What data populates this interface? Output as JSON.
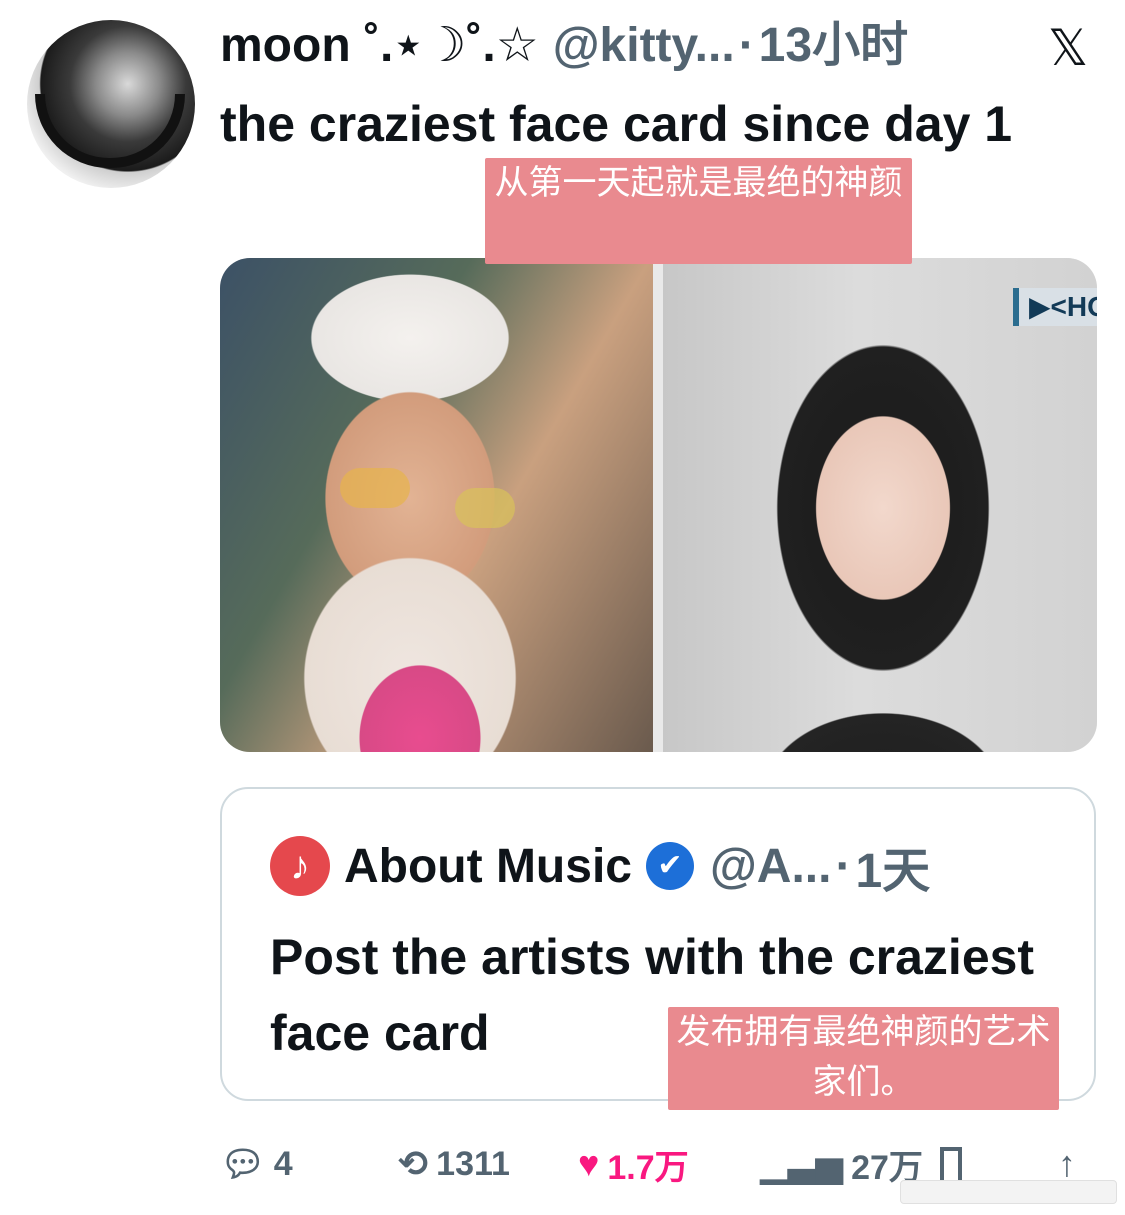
{
  "tweet": {
    "name": "moon ˚.⋆☽˚.☆",
    "handle": "@kitty...",
    "dot": "·",
    "time": "13小时",
    "x_logo": "𝕏",
    "text": "the craziest face card since day 1",
    "caption": "从第一天起就是最绝的神颜"
  },
  "media": {
    "right_badge": "▶<HOI"
  },
  "quote": {
    "icon": "♪",
    "name": "About Music",
    "verified_icon": "✔",
    "handle": "@A...",
    "dot": "·",
    "time": "1天",
    "text": "Post the artists with the craziest face card",
    "caption": "发布拥有最绝神颜的艺术家们。"
  },
  "actions": {
    "reply_icon": "reply-icon",
    "reply_count": "4",
    "retweet_count": "1311",
    "like_count": "1.7万",
    "views_count": "27万"
  },
  "colors": {
    "like": "#f91880",
    "verified": "#1d6fd8",
    "caption_bg": "#e98a8f",
    "muted": "#536471"
  }
}
